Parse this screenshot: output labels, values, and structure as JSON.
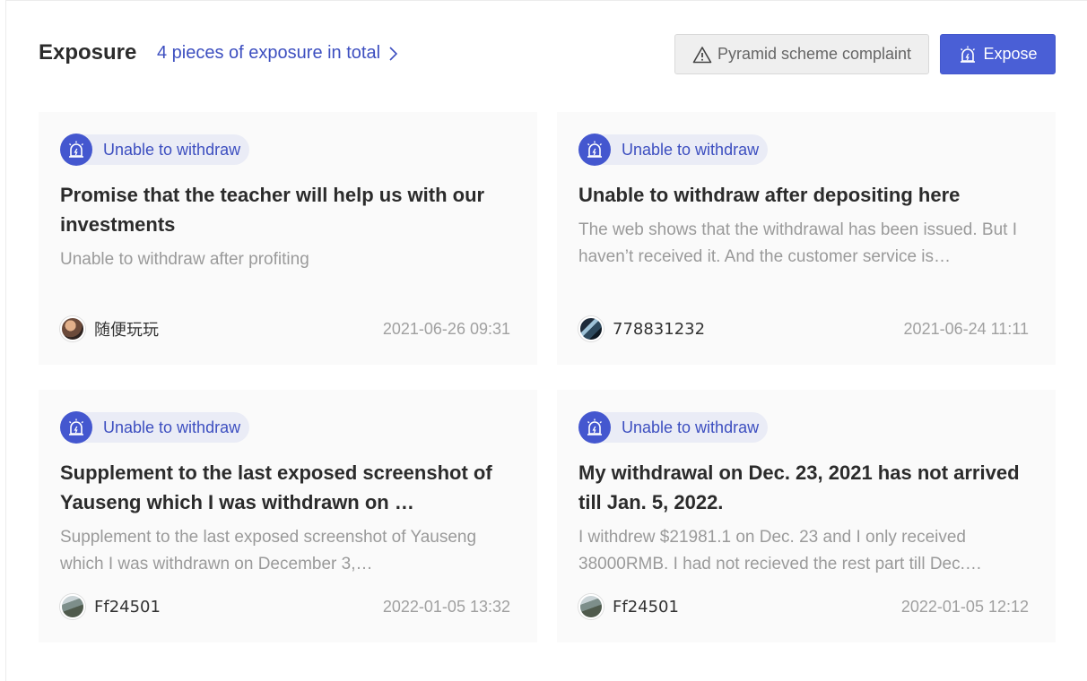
{
  "header": {
    "title": "Exposure",
    "total_link": "4 pieces of exposure in total",
    "complaint_button": "Pyramid scheme complaint",
    "expose_button": "Expose"
  },
  "cards": [
    {
      "tag": "Unable to withdraw",
      "title": "Promise that the teacher will help us with our investments",
      "description": "Unable to withdraw after profiting",
      "author": "随便玩玩",
      "date": "2021-06-26 09:31"
    },
    {
      "tag": "Unable to withdraw",
      "title": "Unable to withdraw after depositing here",
      "description": "The web shows that the withdrawal has been issued. But I haven’t received it. And the customer service is…",
      "author": "778831232",
      "date": "2021-06-24 11:11"
    },
    {
      "tag": "Unable to withdraw",
      "title": "Supplement to the last exposed screenshot of Yauseng which I was withdrawn on …",
      "description": "Supplement to the last exposed screenshot of Yauseng which I was withdrawn on December 3,…",
      "author": "Ff24501",
      "date": "2022-01-05 13:32"
    },
    {
      "tag": "Unable to withdraw",
      "title": "My withdrawal on Dec. 23, 2021 has not arrived till Jan. 5, 2022.",
      "description": "I withdrew $21981.1 on Dec. 23 and I only received 38000RMB. I had not recieved the rest part till Dec.…",
      "author": "Ff24501",
      "date": "2022-01-05 12:12"
    }
  ],
  "colors": {
    "accent": "#4a5fd6",
    "link": "#3d4fc0",
    "tag_bg": "#eaecf6",
    "card_bg": "#fafafa"
  }
}
